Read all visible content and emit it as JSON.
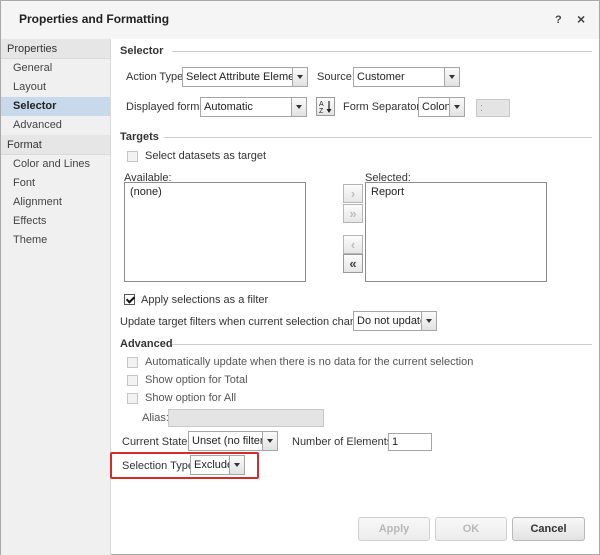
{
  "title": "Properties and Formatting",
  "title_buttons": {
    "help": "?",
    "close": "×"
  },
  "sidebar": {
    "groups": [
      {
        "header": "Properties",
        "items": [
          "General",
          "Layout",
          "Selector",
          "Advanced"
        ]
      },
      {
        "header": "Format",
        "items": [
          "Color and Lines",
          "Font",
          "Alignment",
          "Effects",
          "Theme"
        ]
      }
    ],
    "active": "Selector"
  },
  "selector": {
    "heading": "Selector",
    "action_type_label": "Action Type:",
    "action_type_value": "Select Attribute Element",
    "source_label": "Source:",
    "source_value": "Customer",
    "displayed_forms_label": "Displayed forms:",
    "displayed_forms_value": "Automatic",
    "form_separator_label": "Form Separator:",
    "form_separator_value": "Colon",
    "form_separator_text": ":"
  },
  "targets": {
    "heading": "Targets",
    "select_datasets_label": "Select datasets as target",
    "available_label": "Available:",
    "available_items": [
      "(none)"
    ],
    "selected_label": "Selected:",
    "selected_items": [
      "Report"
    ],
    "apply_filter_label": "Apply selections as a filter",
    "update_label": "Update target filters when current selection changes:",
    "update_value": "Do not update"
  },
  "advanced": {
    "heading": "Advanced",
    "auto_update_label": "Automatically update when there is no data for the current selection",
    "show_total_label": "Show option for Total",
    "show_all_label": "Show option for All",
    "alias_label": "Alias:",
    "current_state_label": "Current State:",
    "current_state_value": "Unset (no filter)",
    "num_elements_label": "Number of Elements:",
    "num_elements_value": "1",
    "selection_type_label": "Selection Type:",
    "selection_type_value": "Exclude"
  },
  "buttons": {
    "apply": "Apply",
    "ok": "OK",
    "cancel": "Cancel"
  },
  "colors": {
    "highlight": "#d62b2b",
    "active_nav": "#c8d9ec"
  }
}
